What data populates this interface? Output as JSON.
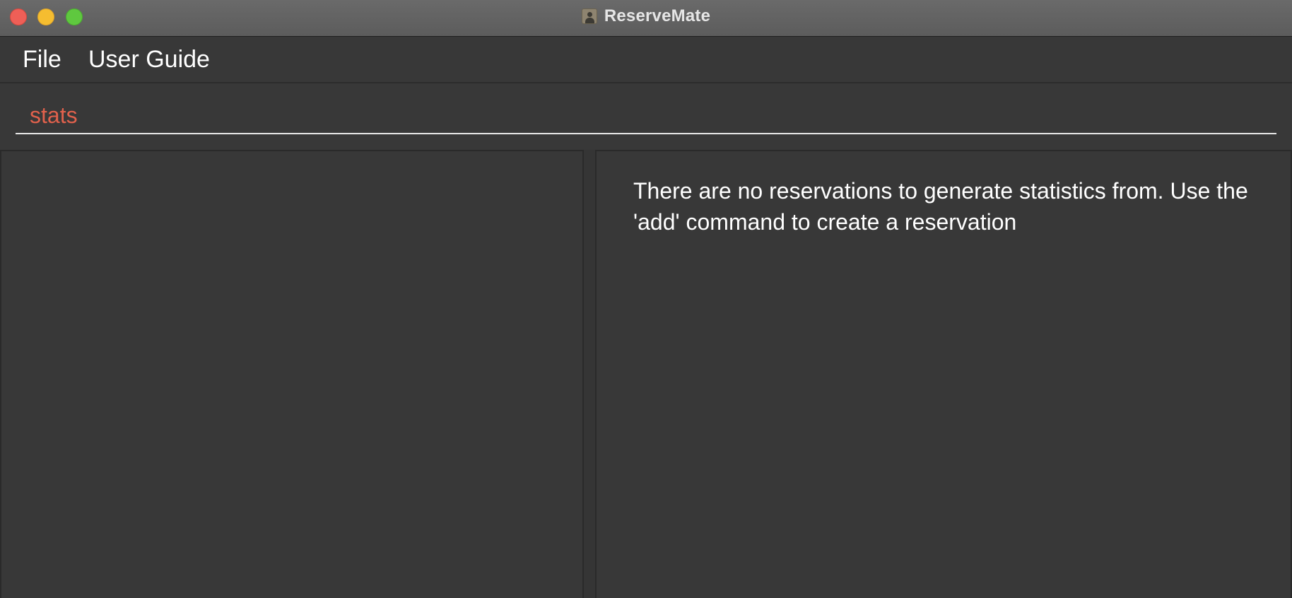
{
  "window": {
    "title": "ReserveMate"
  },
  "menu": {
    "items": [
      {
        "label": "File"
      },
      {
        "label": "User Guide"
      }
    ]
  },
  "command": {
    "value": "stats"
  },
  "result": {
    "message": "There are no reservations to generate statistics from. Use the 'add' command to create a reservation"
  },
  "colors": {
    "command_text": "#e0614c",
    "background": "#383838",
    "close": "#ee5f57",
    "minimize": "#f5bd30",
    "zoom": "#5fc83f"
  },
  "icons": {
    "app": "contact-card-icon"
  }
}
